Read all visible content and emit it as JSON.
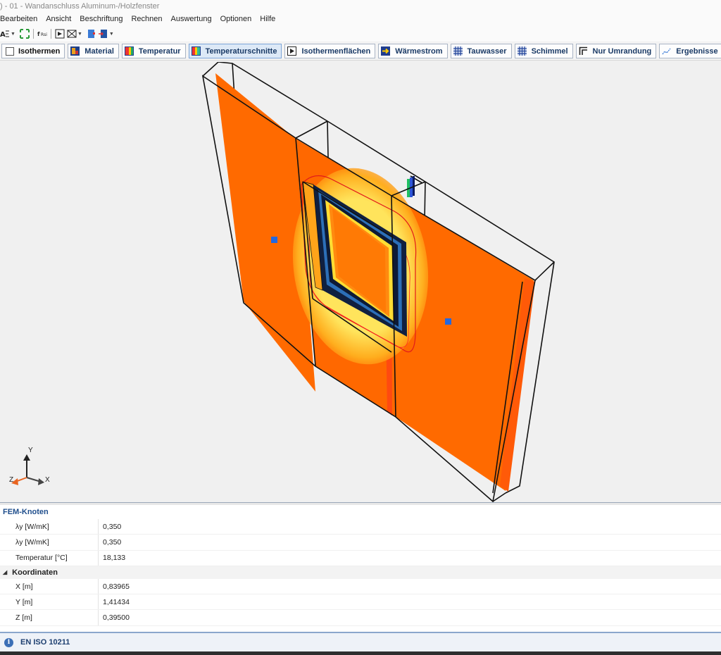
{
  "window": {
    "title": ") - 01 - Wandanschluss Aluminum-/Holzfenster"
  },
  "menu": [
    "Bearbeiten",
    "Ansicht",
    "Beschriftung",
    "Rechnen",
    "Auswertung",
    "Optionen",
    "Hilfe"
  ],
  "toolbar": {
    "isothermen": "Isothermen",
    "material": "Material",
    "temperatur": "Temperatur",
    "temperaturschnitte": "Temperaturschnitte",
    "isothermenflaechen": "Isothermenflächen",
    "waermestrom": "Wärmestrom",
    "tauwasser": "Tauwasser",
    "schimmel": "Schimmel",
    "nur_umrandung": "Nur Umrandung",
    "ergebnisse": "Ergebnisse"
  },
  "axes": {
    "x": "X",
    "y": "Y",
    "z": "Z"
  },
  "properties": {
    "header": "FEM-Knoten",
    "rows": [
      {
        "name": "λy [W/mK]",
        "value": "0,350"
      },
      {
        "name": "λy [W/mK]",
        "value": "0,350"
      },
      {
        "name": "Temperatur [°C]",
        "value": "18,133"
      }
    ],
    "category": "Koordinaten",
    "coords": [
      {
        "name": "X [m]",
        "value": "0,83965"
      },
      {
        "name": "Y [m]",
        "value": "1,41434"
      },
      {
        "name": "Z [m]",
        "value": "0,39500"
      }
    ]
  },
  "status": {
    "text": "EN ISO 10211"
  },
  "colors": {
    "orange": "#ff6a00",
    "hot": "#ffcc00",
    "accent": "#3b6fb6"
  }
}
